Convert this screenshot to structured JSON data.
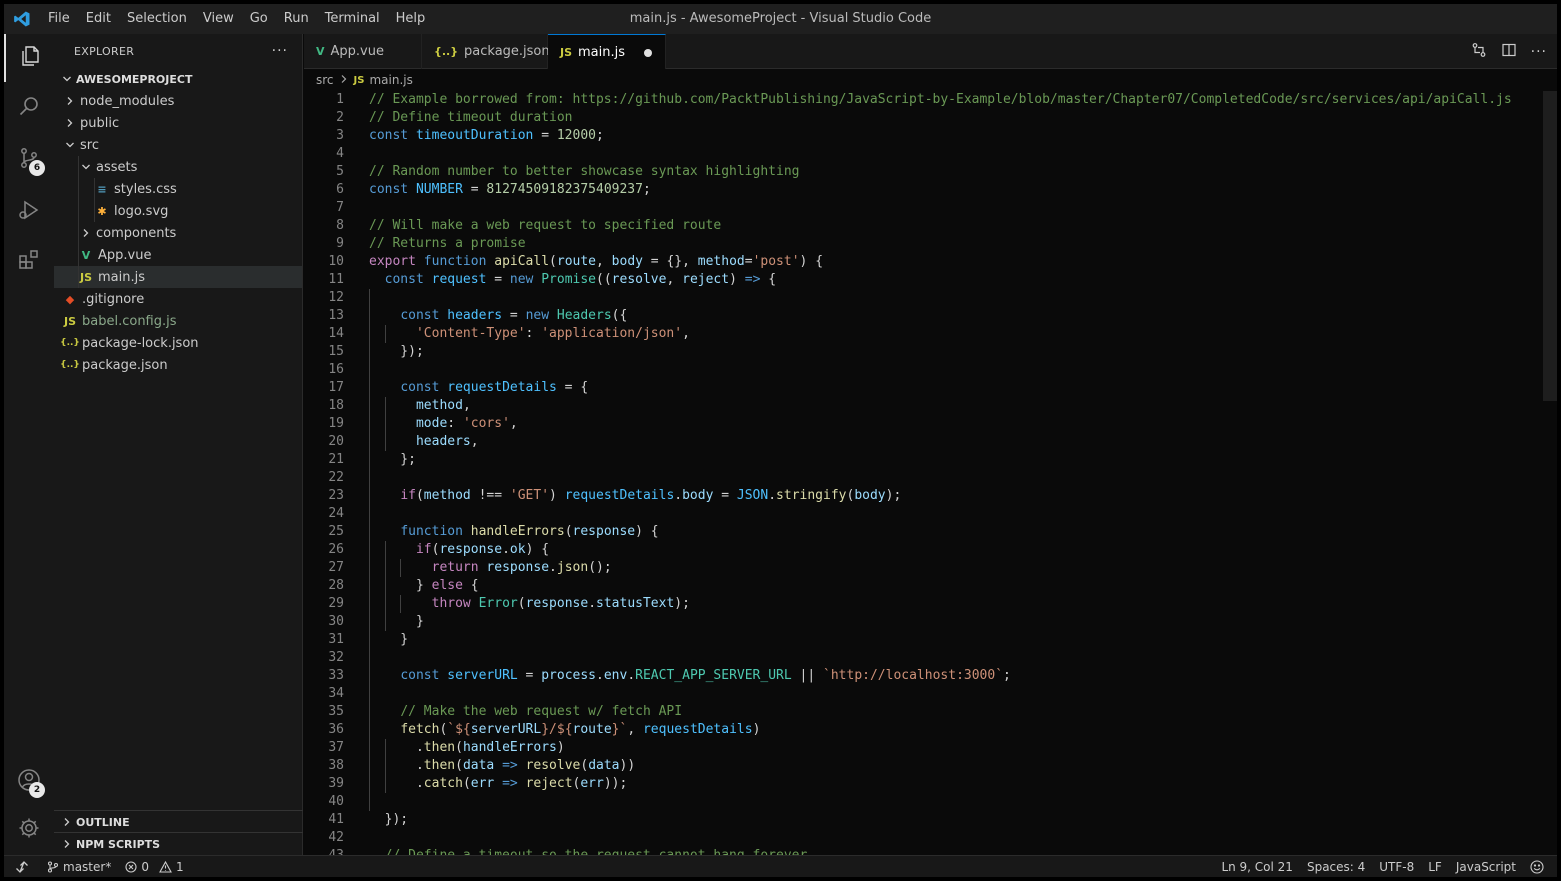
{
  "window": {
    "title": "main.js - AwesomeProject - Visual Studio Code"
  },
  "menu": [
    "File",
    "Edit",
    "Selection",
    "View",
    "Go",
    "Run",
    "Terminal",
    "Help"
  ],
  "activity": {
    "scm_badge": "6",
    "accounts_badge": "2"
  },
  "sidebar": {
    "title": "EXPLORER",
    "project": "AWESOMEPROJECT",
    "tree": [
      {
        "label": "node_modules",
        "depth": 0,
        "kind": "folder",
        "open": false
      },
      {
        "label": "public",
        "depth": 0,
        "kind": "folder",
        "open": false
      },
      {
        "label": "src",
        "depth": 0,
        "kind": "folder",
        "open": true
      },
      {
        "label": "assets",
        "depth": 1,
        "kind": "folder",
        "open": true
      },
      {
        "label": "styles.css",
        "depth": 2,
        "kind": "css"
      },
      {
        "label": "logo.svg",
        "depth": 2,
        "kind": "svg"
      },
      {
        "label": "components",
        "depth": 1,
        "kind": "folder",
        "open": false
      },
      {
        "label": "App.vue",
        "depth": 1,
        "kind": "vue"
      },
      {
        "label": "main.js",
        "depth": 1,
        "kind": "js",
        "selected": true
      },
      {
        "label": ".gitignore",
        "depth": 0,
        "kind": "git"
      },
      {
        "label": "babel.config.js",
        "depth": 0,
        "kind": "js",
        "muted": true
      },
      {
        "label": "package-lock.json",
        "depth": 0,
        "kind": "json"
      },
      {
        "label": "package.json",
        "depth": 0,
        "kind": "json"
      }
    ],
    "outline_label": "OUTLINE",
    "npm_label": "NPM SCRIPTS"
  },
  "tabs": [
    {
      "label": "App.vue",
      "kind": "vue",
      "active": false
    },
    {
      "label": "package.json",
      "kind": "json",
      "active": false
    },
    {
      "label": "main.js",
      "kind": "js",
      "active": true,
      "dirty": true
    }
  ],
  "breadcrumb": [
    "src",
    "main.js"
  ],
  "code_lines": [
    [
      [
        "// Example borrowed from: https://github.com/PacktPublishing/JavaScript-by-Example/blob/master/Chapter07/CompletedCode/src/services/api/apiCall.js",
        "cmt"
      ]
    ],
    [
      [
        "// Define timeout duration",
        "cmt"
      ]
    ],
    [
      [
        "const ",
        "dec"
      ],
      [
        "timeoutDuration",
        "const"
      ],
      [
        " = ",
        ""
      ],
      [
        "12000",
        "num"
      ],
      [
        ";",
        ""
      ]
    ],
    [],
    [
      [
        "// Random number to better showcase syntax highlighting",
        "cmt"
      ]
    ],
    [
      [
        "const ",
        "dec"
      ],
      [
        "NUMBER",
        "const"
      ],
      [
        " = ",
        ""
      ],
      [
        "81274509182375409237",
        "num"
      ],
      [
        ";",
        ""
      ]
    ],
    [],
    [
      [
        "// Will make a web request to specified route",
        "cmt"
      ]
    ],
    [
      [
        "// Returns a promise",
        "cmt"
      ]
    ],
    [
      [
        "export ",
        "kw"
      ],
      [
        "function ",
        "dec"
      ],
      [
        "apiCall",
        "fn"
      ],
      [
        "(",
        ""
      ],
      [
        "route",
        "var"
      ],
      [
        ", ",
        ""
      ],
      [
        "body",
        "var"
      ],
      [
        " = {}, ",
        ""
      ],
      [
        "method",
        "var"
      ],
      [
        "=",
        ""
      ],
      [
        "'post'",
        "str"
      ],
      [
        ") {",
        ""
      ]
    ],
    [
      [
        "  ",
        ""
      ],
      [
        "const ",
        "dec"
      ],
      [
        "request",
        "const"
      ],
      [
        " = ",
        ""
      ],
      [
        "new ",
        "dec"
      ],
      [
        "Promise",
        "cls"
      ],
      [
        "((",
        ""
      ],
      [
        "resolve",
        "var"
      ],
      [
        ", ",
        ""
      ],
      [
        "reject",
        "var"
      ],
      [
        ") ",
        ""
      ],
      [
        "=>",
        "dec"
      ],
      [
        " {",
        ""
      ]
    ],
    [],
    [
      [
        "    ",
        ""
      ],
      [
        "const ",
        "dec"
      ],
      [
        "headers",
        "const"
      ],
      [
        " = ",
        ""
      ],
      [
        "new ",
        "dec"
      ],
      [
        "Headers",
        "cls"
      ],
      [
        "({",
        ""
      ]
    ],
    [
      [
        "      ",
        ""
      ],
      [
        "'Content-Type'",
        "str"
      ],
      [
        ": ",
        ""
      ],
      [
        "'application/json'",
        "str"
      ],
      [
        ",",
        ""
      ]
    ],
    [
      [
        "    });",
        ""
      ]
    ],
    [],
    [
      [
        "    ",
        ""
      ],
      [
        "const ",
        "dec"
      ],
      [
        "requestDetails",
        "const"
      ],
      [
        " = {",
        ""
      ]
    ],
    [
      [
        "      ",
        ""
      ],
      [
        "method",
        "var"
      ],
      [
        ",",
        ""
      ]
    ],
    [
      [
        "      ",
        ""
      ],
      [
        "mode",
        "var"
      ],
      [
        ": ",
        ""
      ],
      [
        "'cors'",
        "str"
      ],
      [
        ",",
        ""
      ]
    ],
    [
      [
        "      ",
        ""
      ],
      [
        "headers",
        "var"
      ],
      [
        ",",
        ""
      ]
    ],
    [
      [
        "    };",
        ""
      ]
    ],
    [],
    [
      [
        "    ",
        ""
      ],
      [
        "if",
        "kw"
      ],
      [
        "(",
        ""
      ],
      [
        "method",
        "var"
      ],
      [
        " !== ",
        ""
      ],
      [
        "'GET'",
        "str"
      ],
      [
        ") ",
        ""
      ],
      [
        "requestDetails",
        "const"
      ],
      [
        ".",
        ""
      ],
      [
        "body",
        "var"
      ],
      [
        " = ",
        ""
      ],
      [
        "JSON",
        "const"
      ],
      [
        ".",
        ""
      ],
      [
        "stringify",
        "fn"
      ],
      [
        "(",
        ""
      ],
      [
        "body",
        "var"
      ],
      [
        ");",
        ""
      ]
    ],
    [],
    [
      [
        "    ",
        ""
      ],
      [
        "function ",
        "dec"
      ],
      [
        "handleErrors",
        "fn"
      ],
      [
        "(",
        ""
      ],
      [
        "response",
        "var"
      ],
      [
        ") {",
        ""
      ]
    ],
    [
      [
        "      ",
        ""
      ],
      [
        "if",
        "kw"
      ],
      [
        "(",
        ""
      ],
      [
        "response",
        "var"
      ],
      [
        ".",
        ""
      ],
      [
        "ok",
        "var"
      ],
      [
        ") {",
        ""
      ]
    ],
    [
      [
        "        ",
        ""
      ],
      [
        "return ",
        "kw"
      ],
      [
        "response",
        "var"
      ],
      [
        ".",
        ""
      ],
      [
        "json",
        "fn"
      ],
      [
        "();",
        ""
      ]
    ],
    [
      [
        "      } ",
        ""
      ],
      [
        "else",
        "kw"
      ],
      [
        " {",
        ""
      ]
    ],
    [
      [
        "        ",
        ""
      ],
      [
        "throw ",
        "kw"
      ],
      [
        "Error",
        "cls"
      ],
      [
        "(",
        ""
      ],
      [
        "response",
        "var"
      ],
      [
        ".",
        ""
      ],
      [
        "statusText",
        "var"
      ],
      [
        ");",
        ""
      ]
    ],
    [
      [
        "      }",
        ""
      ]
    ],
    [
      [
        "    }",
        ""
      ]
    ],
    [],
    [
      [
        "    ",
        ""
      ],
      [
        "const ",
        "dec"
      ],
      [
        "serverURL",
        "const"
      ],
      [
        " = ",
        ""
      ],
      [
        "process",
        "var"
      ],
      [
        ".",
        ""
      ],
      [
        "env",
        "var"
      ],
      [
        ".",
        ""
      ],
      [
        "REACT_APP_SERVER_URL",
        "cls"
      ],
      [
        " || ",
        ""
      ],
      [
        "`http://localhost:3000`",
        "str"
      ],
      [
        ";",
        ""
      ]
    ],
    [],
    [
      [
        "    ",
        ""
      ],
      [
        "// Make the web request w/ fetch API",
        "cmt"
      ]
    ],
    [
      [
        "    ",
        ""
      ],
      [
        "fetch",
        "fn"
      ],
      [
        "(",
        ""
      ],
      [
        "`${",
        "str"
      ],
      [
        "serverURL",
        "var"
      ],
      [
        "}/${",
        "str"
      ],
      [
        "route",
        "var"
      ],
      [
        "}`",
        "str"
      ],
      [
        ", ",
        ""
      ],
      [
        "requestDetails",
        "const"
      ],
      [
        ")",
        ""
      ]
    ],
    [
      [
        "      .",
        ""
      ],
      [
        "then",
        "fn"
      ],
      [
        "(",
        ""
      ],
      [
        "handleErrors",
        "var"
      ],
      [
        ")",
        ""
      ]
    ],
    [
      [
        "      .",
        ""
      ],
      [
        "then",
        "fn"
      ],
      [
        "(",
        ""
      ],
      [
        "data",
        "var"
      ],
      [
        " ",
        ""
      ],
      [
        "=>",
        "dec"
      ],
      [
        " ",
        ""
      ],
      [
        "resolve",
        "fn"
      ],
      [
        "(",
        ""
      ],
      [
        "data",
        "var"
      ],
      [
        "))",
        ""
      ]
    ],
    [
      [
        "      .",
        ""
      ],
      [
        "catch",
        "fn"
      ],
      [
        "(",
        ""
      ],
      [
        "err",
        "var"
      ],
      [
        " ",
        ""
      ],
      [
        "=>",
        "dec"
      ],
      [
        " ",
        ""
      ],
      [
        "reject",
        "fn"
      ],
      [
        "(",
        ""
      ],
      [
        "err",
        "var"
      ],
      [
        "));",
        ""
      ]
    ],
    [],
    [
      [
        "  });",
        ""
      ]
    ],
    [],
    [
      [
        "  ",
        ""
      ],
      [
        "// Define a timeout so the request cannot hang forever",
        "cmt"
      ]
    ]
  ],
  "guides": [
    [],
    [],
    [],
    [],
    [],
    [],
    [],
    [],
    [],
    [],
    [],
    [
      1
    ],
    [
      1
    ],
    [
      1,
      2
    ],
    [
      1
    ],
    [
      1
    ],
    [
      1
    ],
    [
      1,
      2
    ],
    [
      1,
      2
    ],
    [
      1,
      2
    ],
    [
      1
    ],
    [
      1
    ],
    [
      1
    ],
    [
      1
    ],
    [
      1
    ],
    [
      1,
      2
    ],
    [
      1,
      2,
      3
    ],
    [
      1,
      2
    ],
    [
      1,
      2,
      3
    ],
    [
      1,
      2
    ],
    [
      1
    ],
    [
      1
    ],
    [
      1
    ],
    [
      1
    ],
    [
      1
    ],
    [
      1
    ],
    [
      1,
      2
    ],
    [
      1,
      2
    ],
    [
      1,
      2
    ],
    [
      1
    ],
    [],
    []
  ],
  "status": {
    "branch": "master*",
    "errors": "0",
    "warnings": "1",
    "position": "Ln 9, Col 21",
    "spaces": "Spaces: 4",
    "encoding": "UTF-8",
    "eol": "LF",
    "language": "JavaScript"
  },
  "colors": {
    "accent": "#0078d4",
    "vue": "#41b883",
    "js": "#cbcb41",
    "css": "#519aba",
    "json": "#cbcb41",
    "git": "#e44d26",
    "svg": "#ffb13b"
  }
}
